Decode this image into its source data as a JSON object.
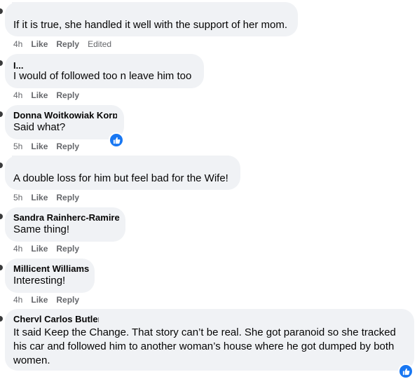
{
  "comments": [
    {
      "author": "",
      "text": "If it is true, she handled it well with the support of her mom.",
      "time": "4h",
      "like": "Like",
      "reply": "Reply",
      "edited": "Edited"
    },
    {
      "author": "I...",
      "text": "I would of followed too n leave him too",
      "time": "4h",
      "like": "Like",
      "reply": "Reply"
    },
    {
      "author": "Donna Wojtkowiak Korp.",
      "text": "Said what?",
      "time": "5h",
      "like": "Like",
      "reply": "Reply"
    },
    {
      "author": "",
      "text": "A double loss for him but feel bad for the Wife!",
      "time": "5h",
      "like": "Like",
      "reply": "Reply"
    },
    {
      "author": "Sandra Rajnherc-Ramirez",
      "text": "Same thing!",
      "time": "4h",
      "like": "Like",
      "reply": "Reply"
    },
    {
      "author": "Millicent Williams",
      "text": "Interesting!",
      "time": "4h",
      "like": "Like",
      "reply": "Reply"
    },
    {
      "author": "Cheryl Carlos Butler",
      "text": "It said Keep the Change. That story can’t be real. She got paranoid so she tracked his car and followed him to another woman’s house where he got dumped by both women."
    }
  ],
  "colors": {
    "bubble": "#f0f2f5",
    "reaction": "#1877f2",
    "meta": "#65676b"
  },
  "icons": {
    "reaction": "like-reaction-icon"
  }
}
